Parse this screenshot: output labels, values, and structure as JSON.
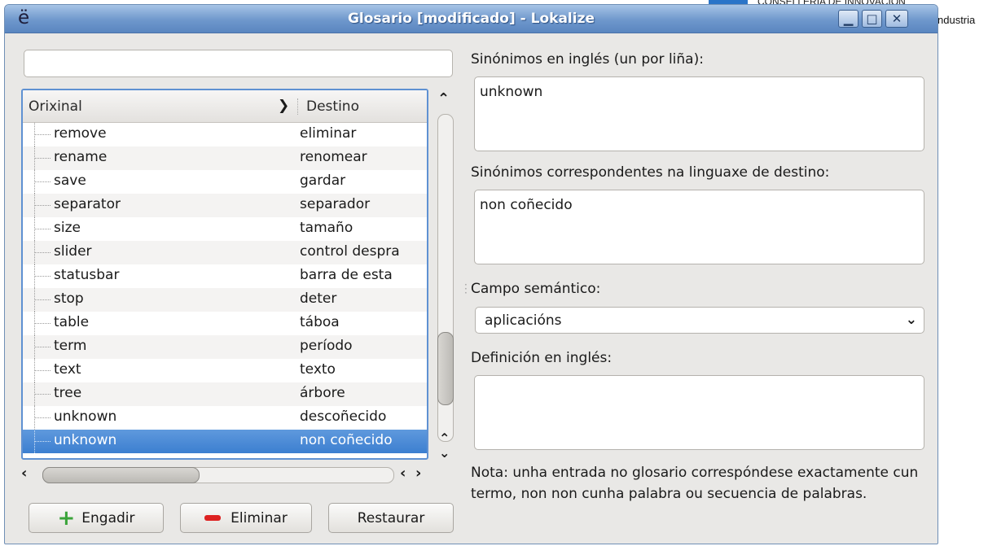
{
  "window": {
    "title": "Glosario [modificado] - Lokalize",
    "app_icon": "ë",
    "controls": {
      "minimize": "minimize-icon",
      "maximize": "maximize-icon",
      "close": "close-icon"
    }
  },
  "background": {
    "top_right_text": "CONSELLERÍA DE INNOVACIÓN",
    "right_text": "ndustria"
  },
  "filter": {
    "value": ""
  },
  "tree": {
    "headers": {
      "original": "Orixinal",
      "target": "Destino"
    },
    "rows": [
      {
        "original": "remove",
        "target": "eliminar"
      },
      {
        "original": "rename",
        "target": "renomear"
      },
      {
        "original": "save",
        "target": "gardar"
      },
      {
        "original": "separator",
        "target": "separador"
      },
      {
        "original": "size",
        "target": "tamaño"
      },
      {
        "original": "slider",
        "target": "control despra"
      },
      {
        "original": "statusbar",
        "target": "barra de esta"
      },
      {
        "original": "stop",
        "target": "deter"
      },
      {
        "original": "table",
        "target": "táboa"
      },
      {
        "original": "term",
        "target": "período"
      },
      {
        "original": "text",
        "target": "texto"
      },
      {
        "original": "tree",
        "target": "árbore"
      },
      {
        "original": "unknown",
        "target": "descoñecido"
      },
      {
        "original": "unknown",
        "target": "non coñecido",
        "selected": true
      }
    ]
  },
  "buttons": {
    "add": "Engadir",
    "remove": "Eliminar",
    "restore": "Restaurar"
  },
  "form": {
    "synonyms_en_label": "Sinónimos en inglés (un por liña):",
    "synonyms_en_value": "unknown",
    "synonyms_target_label": "Sinónimos correspondentes na linguaxe de destino:",
    "synonyms_target_value": "non coñecido",
    "semantic_label": "Campo semántico:",
    "semantic_value": "aplicacións",
    "definition_label": "Definición en inglés:",
    "definition_value": ""
  },
  "note": "Nota: unha entrada no glosario correspóndese exactamente cun termo, non non cunha palabra ou secuencia de palabras.",
  "colors": {
    "selection": "#3c7fd0",
    "title_bar": "#6e97cc",
    "add_icon": "#3aa43a",
    "remove_icon": "#dd2222"
  }
}
